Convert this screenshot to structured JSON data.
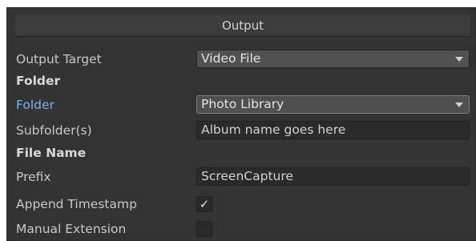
{
  "section": {
    "title": "Output"
  },
  "fields": {
    "output_target": {
      "label": "Output Target",
      "value": "Video File"
    },
    "folder_heading": "Folder",
    "folder": {
      "label": "Folder",
      "value": "Photo Library"
    },
    "subfolder": {
      "label": "Subfolder(s)",
      "value": "Album name goes here"
    },
    "file_name_heading": "File Name",
    "prefix": {
      "label": "Prefix",
      "value": "ScreenCapture"
    },
    "append_timestamp": {
      "label": "Append Timestamp",
      "checked": true,
      "glyph": "✓"
    },
    "manual_extension": {
      "label": "Manual Extension",
      "checked": false
    }
  },
  "icons": {
    "dropdown_arrow": "triangle-down-icon",
    "checkmark": "checkmark-icon"
  },
  "colors": {
    "panel_bg": "#333333",
    "header_bg": "#3c3c3c",
    "focus_border": "#4d8ad6",
    "focused_label": "#7ab0f5"
  }
}
